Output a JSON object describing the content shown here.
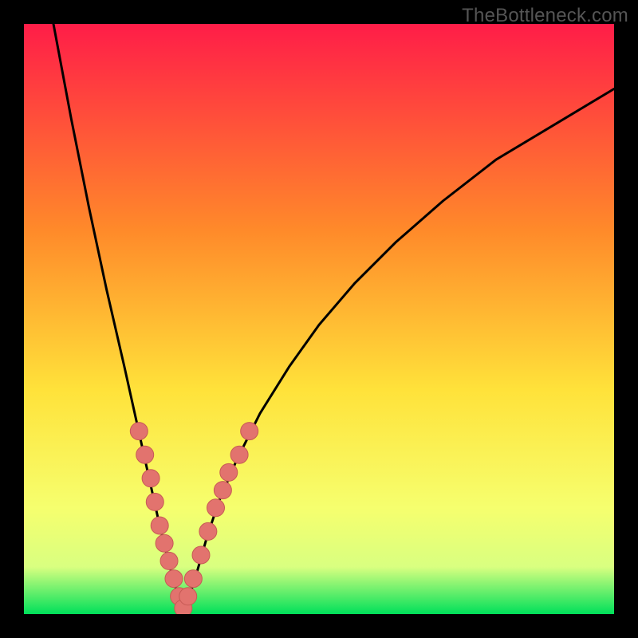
{
  "watermark": "TheBottleneck.com",
  "colors": {
    "frame": "#000000",
    "gradient_top": "#ff1d48",
    "gradient_mid1": "#ff8a2a",
    "gradient_mid2": "#ffe23a",
    "gradient_low1": "#f6ff6e",
    "gradient_low2": "#d9ff80",
    "gradient_bottom": "#00e05a",
    "curve": "#000000",
    "marker_fill": "#e2736e",
    "marker_stroke": "#c75a55"
  },
  "chart_data": {
    "type": "line",
    "title": "",
    "xlabel": "",
    "ylabel": "",
    "xlim": [
      0,
      100
    ],
    "ylim": [
      0,
      100
    ],
    "x_optimum": 27,
    "series": [
      {
        "name": "bottleneck-curve",
        "x": [
          5,
          8,
          11,
          14,
          17,
          19,
          21,
          23,
          25,
          27,
          29,
          31,
          33,
          36,
          40,
          45,
          50,
          56,
          63,
          71,
          80,
          90,
          100
        ],
        "y": [
          100,
          84,
          69,
          55,
          42,
          33,
          24,
          15,
          7,
          0,
          6,
          13,
          19,
          26,
          34,
          42,
          49,
          56,
          63,
          70,
          77,
          83,
          89
        ]
      }
    ],
    "markers": {
      "name": "featured-points",
      "x": [
        19.5,
        20.5,
        21.5,
        22.2,
        23.0,
        23.8,
        24.6,
        25.4,
        26.3,
        27.0,
        27.8,
        28.7,
        30.0,
        31.2,
        32.5,
        33.7,
        34.7,
        36.5,
        38.2
      ],
      "y": [
        31,
        27,
        23,
        19,
        15,
        12,
        9,
        6,
        3,
        1,
        3,
        6,
        10,
        14,
        18,
        21,
        24,
        27,
        31
      ]
    }
  }
}
